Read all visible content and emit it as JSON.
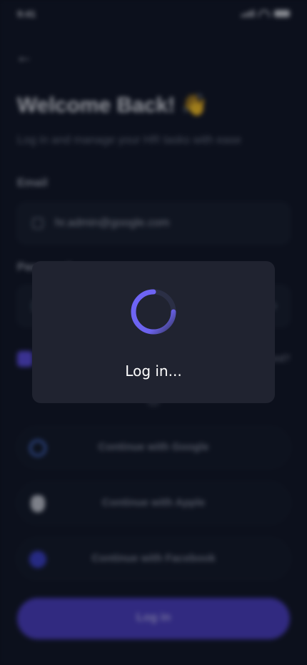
{
  "status_bar": {
    "time": "9:41"
  },
  "screen": {
    "title": "Welcome Back! 👋",
    "subtitle": "Log in and manage your HR tasks with ease",
    "email_label": "Email",
    "email_value": "hr.admin@google.com",
    "password_label": "Password",
    "forgot_password": "Forgot password?",
    "remember_checked": true
  },
  "social": [
    {
      "label": "Continue with Google",
      "icon": "google-icon"
    },
    {
      "label": "Continue with Apple",
      "icon": "apple-icon"
    },
    {
      "label": "Continue with Facebook",
      "icon": "facebook-icon"
    }
  ],
  "login_button": {
    "label": "Log in"
  },
  "loading": {
    "text": "Log in..."
  },
  "colors": {
    "accent": "#6c5ce7",
    "dialog": "#202330",
    "background": "#111624"
  }
}
